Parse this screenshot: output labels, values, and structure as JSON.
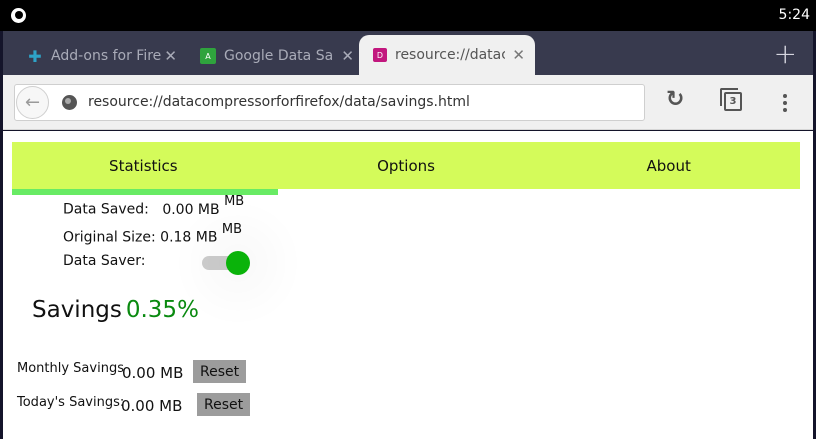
{
  "status_bar": {
    "time": "5:24"
  },
  "tabs": [
    {
      "title": "Add-ons for Firefox",
      "favicon_color": "#2ea3c8",
      "active": false
    },
    {
      "title": "Google Data Saver",
      "favicon_color": "#2fa33d",
      "favicon_letter": "A",
      "active": false
    },
    {
      "title": "resource://datacompressor",
      "favicon_color": "#c2177e",
      "favicon_letter": "D",
      "active": true
    }
  ],
  "toolbar": {
    "url": "resource://datacompressorforfirefox/data/savings.html",
    "tab_count": "3"
  },
  "nav": {
    "items": [
      "Statistics",
      "Options",
      "About"
    ],
    "active_index": 0,
    "bar_color": "#d4fb5a"
  },
  "stats": {
    "data_saved_label": "Data Saved:",
    "data_saved_value": "0.00 MB",
    "data_saved_unit": "MB",
    "original_size_label": "Original Size:",
    "original_size_value": "0.18 MB",
    "original_size_unit": "MB",
    "data_saver_label": "Data Saver:",
    "data_saver_on": true
  },
  "savings": {
    "label": "Savings",
    "percent": "0.35%"
  },
  "monthly": {
    "label": "Monthly Savings",
    "value": "0.00 MB",
    "reset_label": "Reset"
  },
  "today": {
    "label": "Today's Savings:",
    "value": "0.00 MB",
    "reset_label": "Reset"
  }
}
